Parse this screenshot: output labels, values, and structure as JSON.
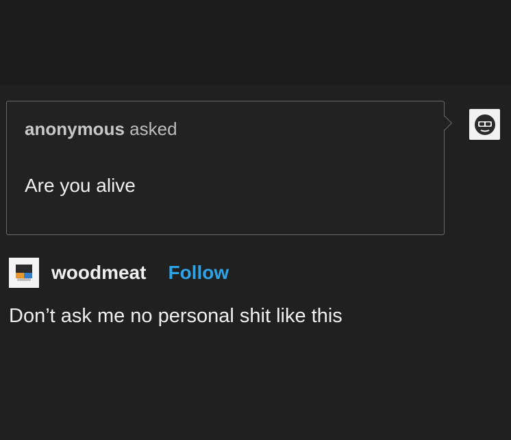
{
  "ask": {
    "asker_name": "anonymous",
    "asked_word": "asked",
    "question": "Are you alive",
    "avatar_icon": "anonymous-ghost-sunglasses-icon"
  },
  "answer": {
    "blog_name": "woodmeat",
    "follow_label": "Follow",
    "text": "Don’t ask me no personal shit like this",
    "avatar_icon": "pixel-block-avatar-icon"
  },
  "colors": {
    "background": "#202020",
    "follow_link": "#2ea3e8",
    "border": "#6a6a6a"
  }
}
